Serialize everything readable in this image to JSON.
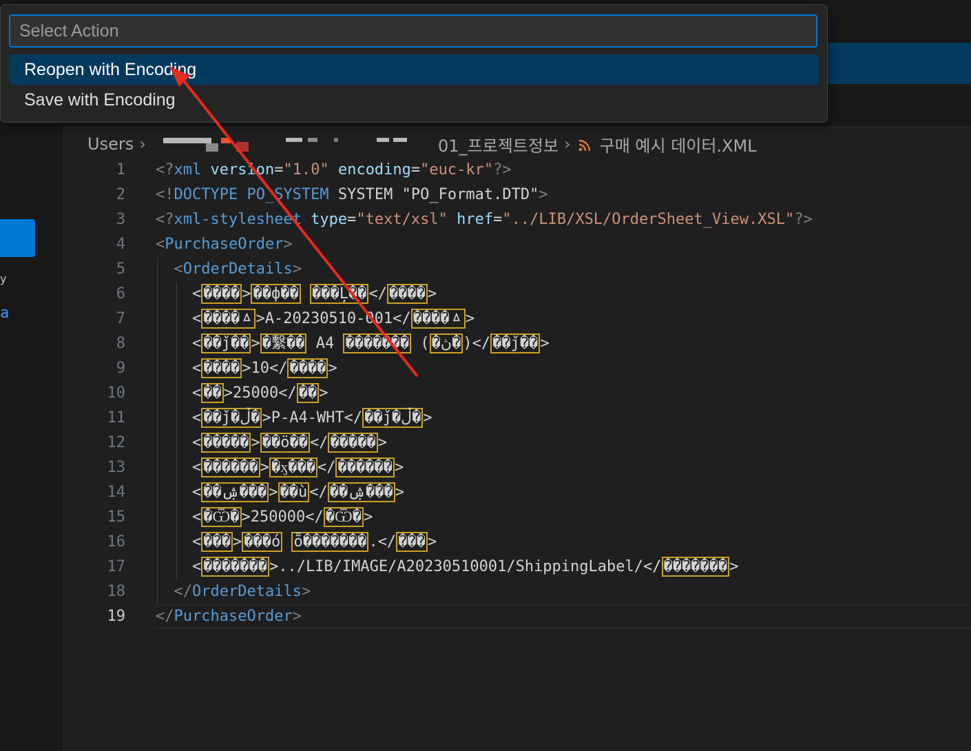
{
  "palette": {
    "placeholder": "Select Action",
    "items": [
      {
        "label": "Reopen with Encoding"
      },
      {
        "label": "Save with Encoding"
      }
    ]
  },
  "breadcrumb": {
    "root": "Users",
    "folder": "01_프로젝트정보",
    "file": "구매 예시 데이터.XML",
    "file_icon": "rss-icon"
  },
  "sidebar": {
    "fragment_a": "a",
    "fragment_b": "y"
  },
  "editor": {
    "line_numbers": [
      "1",
      "2",
      "3",
      "4",
      "5",
      "6",
      "7",
      "8",
      "9",
      "10",
      "11",
      "12",
      "13",
      "14",
      "15",
      "16",
      "17",
      "18",
      "19"
    ],
    "active_line": "19",
    "l1": {
      "open": "<?",
      "name": "xml",
      "a1": "version",
      "eq": "=",
      "v1": "\"1.0\"",
      "a2": "encoding",
      "v2": "\"euc-kr\"",
      "close": "?>"
    },
    "l2": {
      "open": "<!",
      "name": "DOCTYPE PO_SYSTEM",
      "kw": "SYSTEM",
      "dtd": "\"PO_Format.DTD\"",
      "close": ">"
    },
    "l3": {
      "open": "<?",
      "name": "xml-stylesheet",
      "a1": "type",
      "eq": "=",
      "v1": "\"text/xsl\"",
      "a2": "href",
      "v2": "\"../LIB/XSL/OrderSheet_View.XSL\"",
      "close": "?>"
    },
    "root_tag": "PurchaseOrder",
    "details_tag": "OrderDetails",
    "lt": "<",
    "gt": ">",
    "lts": "</",
    "rows": [
      {
        "tag": "����",
        "value_m": "��ф��",
        "value_t": " ",
        "value_m2": "���Ļ��",
        "tag2": "����"
      },
      {
        "tag": "����ㅿ",
        "value_t": "A-20230510-001",
        "tag2": "����ㅿ"
      },
      {
        "tag": "��ǰ��",
        "value_m": "�繫��",
        "value_t": " A4 ",
        "value_m2": "�������",
        "value_t2": " (",
        "value_m3": "�ڽ�",
        "value_t3": ")",
        "tag2": "��ǰ��"
      },
      {
        "tag": "����",
        "value_t": "10",
        "tag2": "����"
      },
      {
        "tag": "��",
        "value_t": "25000",
        "tag2": "��"
      },
      {
        "tag": "��ǰ�ڵ�",
        "value_t": "P-A4-WHT",
        "tag2": "��ǰ�ڵ�"
      },
      {
        "tag": "�����",
        "value_m": "��ö��",
        "tag2": "�����"
      },
      {
        "tag": "������",
        "value_m": "�ӽ���",
        "tag2": "������"
      },
      {
        "tag": "��ۺ���",
        "value_m": "��ù",
        "tag2": "��ۺ���"
      },
      {
        "tag": "�Ѿ�",
        "value_t": "250000",
        "tag2": "�Ѿ�"
      },
      {
        "tag": "���",
        "value_m": "���ó",
        "value_t": " ",
        "value_m2": "ȭ�������",
        "value_t2": ".",
        "tag2": "���"
      },
      {
        "tag": "�������",
        "value_t": "../LIB/IMAGE/A20230510001/ShippingLabel/",
        "tag2": "�������"
      }
    ]
  },
  "colors": {
    "accent": "#0078d4",
    "selection": "#04395e",
    "garbled_box": "#c9a227",
    "arrow": "#e8291c"
  }
}
